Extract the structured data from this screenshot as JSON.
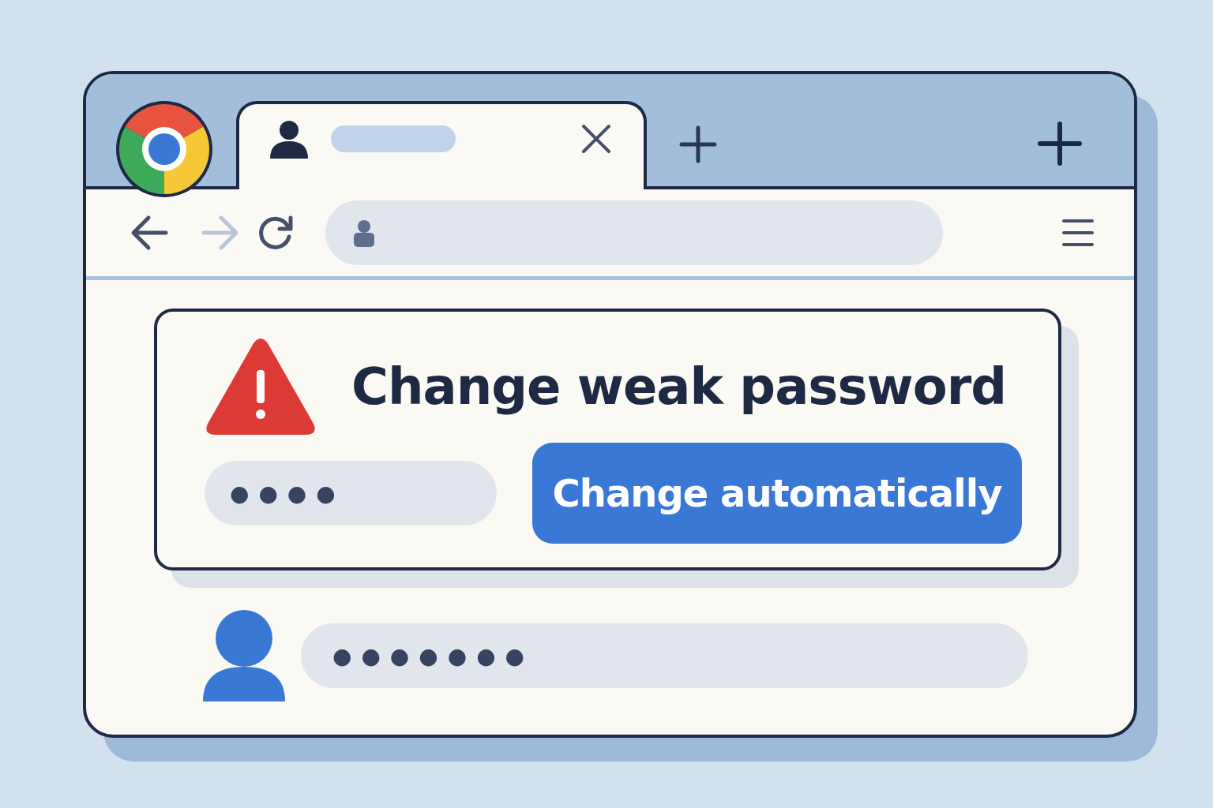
{
  "tabs": [
    {
      "selected": true
    }
  ],
  "navigation": {
    "back_disabled": false,
    "forward_disabled": true
  },
  "alert": {
    "title": "Change weak password",
    "password_field": {
      "value": "●●●●"
    },
    "button": "Change automatically"
  },
  "saved_password": {
    "value": "●●●●●●●"
  }
}
